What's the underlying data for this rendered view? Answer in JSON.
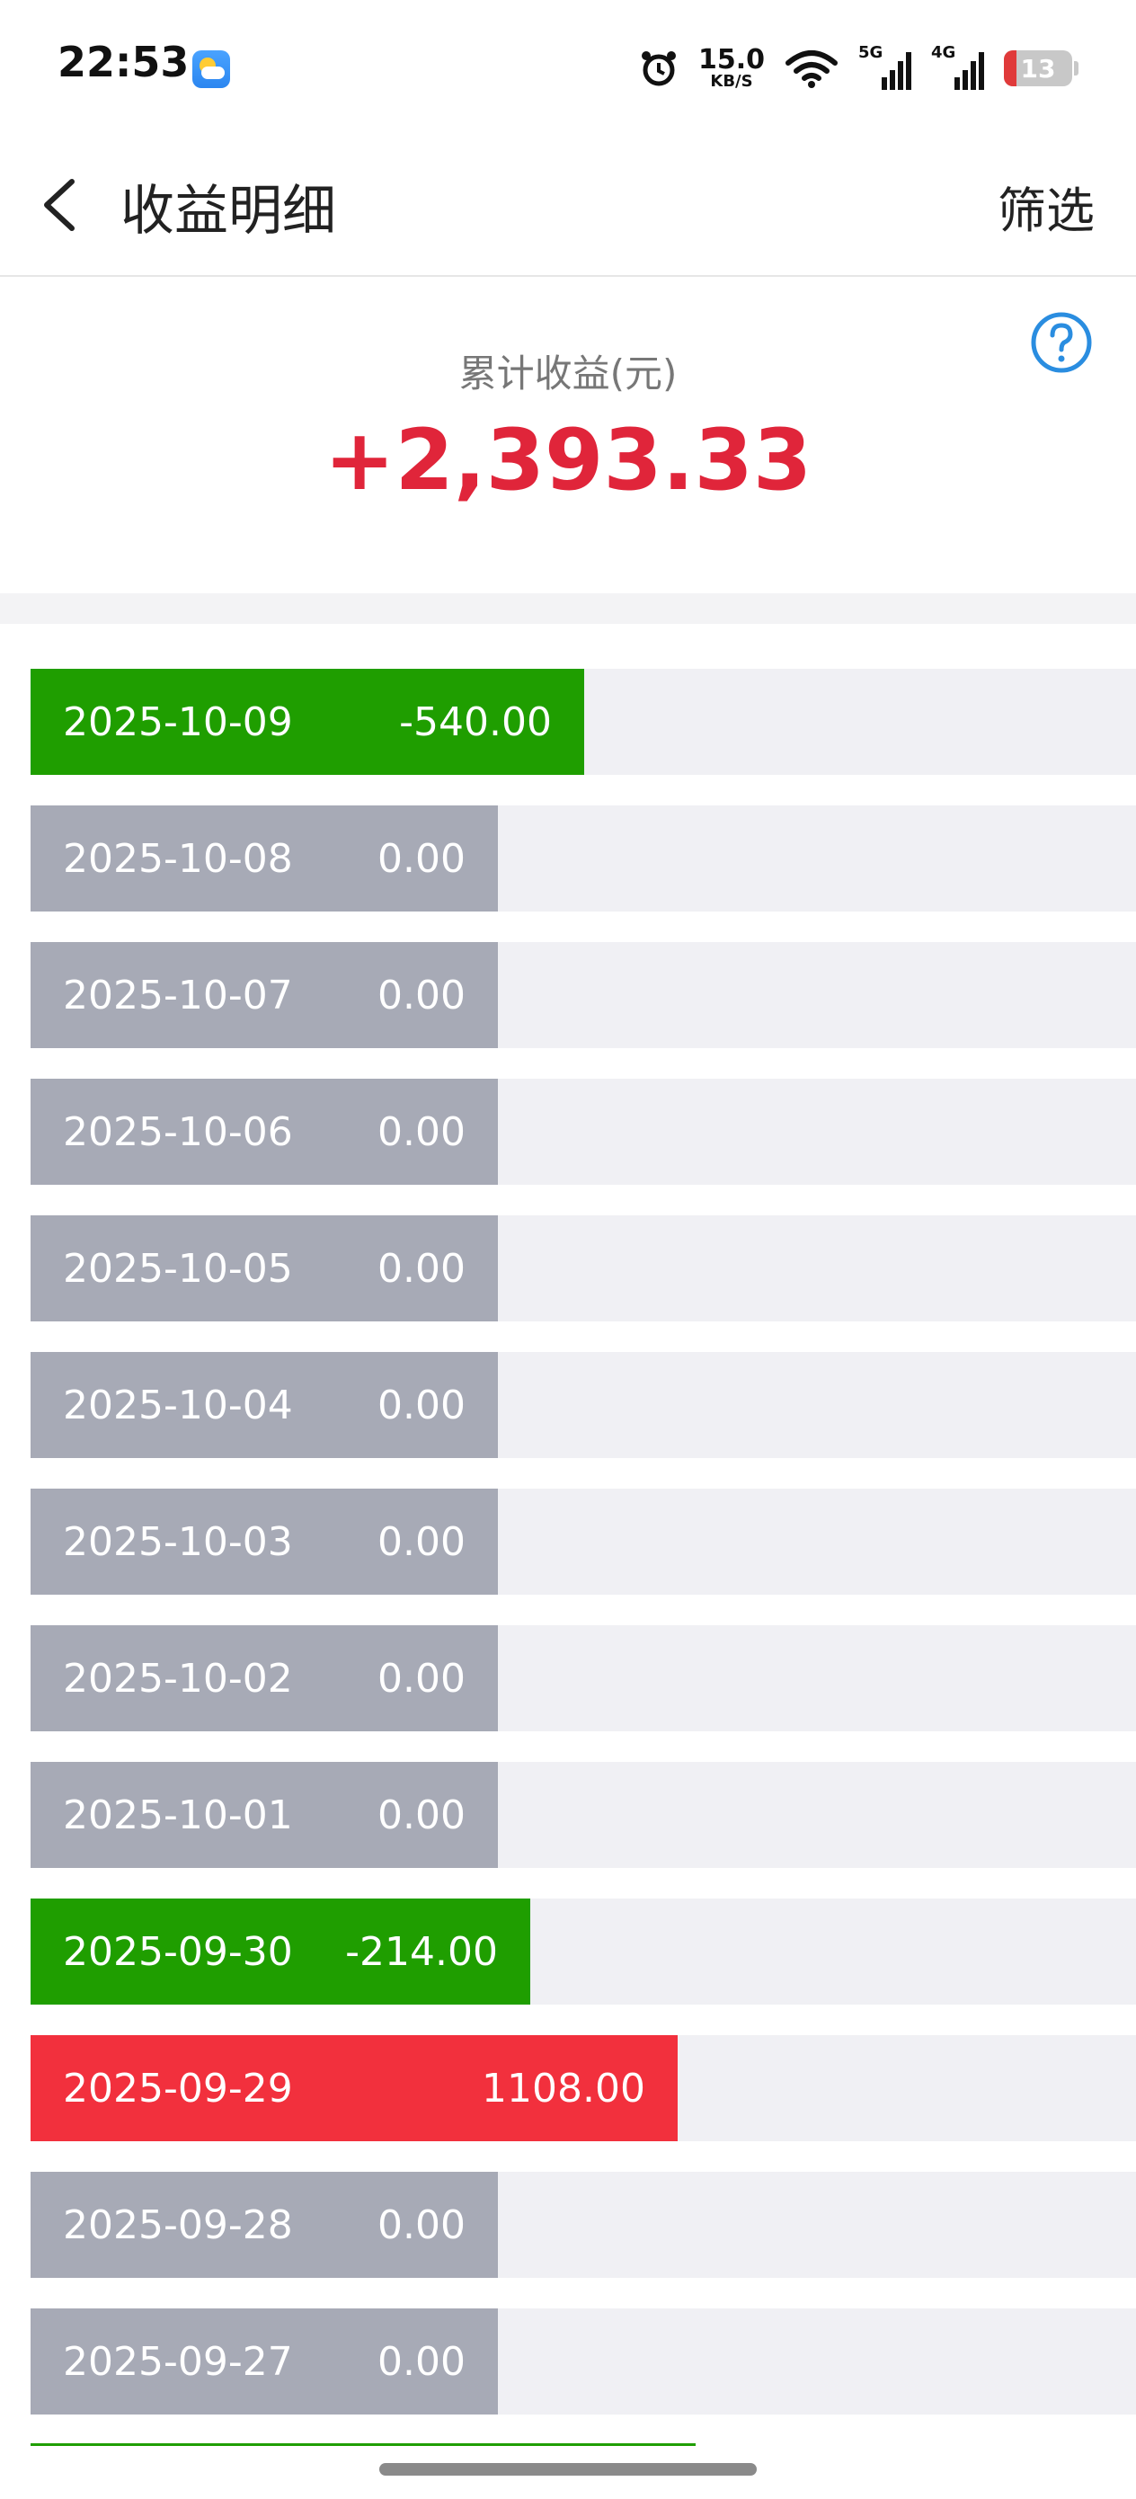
{
  "status_bar": {
    "time": "22:53",
    "net_speed_value": "15.0",
    "net_speed_unit": "KB/S",
    "signal_1_label": "5G",
    "signal_2_label": "4G",
    "battery_level": "13"
  },
  "header": {
    "title": "收益明细",
    "filter_label": "筛选"
  },
  "summary": {
    "label": "累计收益(元)",
    "value": "+2,393.33"
  },
  "colors": {
    "negative": "#1f9e00",
    "positive": "#f2303d",
    "zero": "#a7aab6",
    "summary_value": "#e0253a"
  },
  "rows": [
    {
      "date": "2025-10-09",
      "amount": "-540.00",
      "kind": "neg",
      "value": -540
    },
    {
      "date": "2025-10-08",
      "amount": "0.00",
      "kind": "zero",
      "value": 0
    },
    {
      "date": "2025-10-07",
      "amount": "0.00",
      "kind": "zero",
      "value": 0
    },
    {
      "date": "2025-10-06",
      "amount": "0.00",
      "kind": "zero",
      "value": 0
    },
    {
      "date": "2025-10-05",
      "amount": "0.00",
      "kind": "zero",
      "value": 0
    },
    {
      "date": "2025-10-04",
      "amount": "0.00",
      "kind": "zero",
      "value": 0
    },
    {
      "date": "2025-10-03",
      "amount": "0.00",
      "kind": "zero",
      "value": 0
    },
    {
      "date": "2025-10-02",
      "amount": "0.00",
      "kind": "zero",
      "value": 0
    },
    {
      "date": "2025-10-01",
      "amount": "0.00",
      "kind": "zero",
      "value": 0
    },
    {
      "date": "2025-09-30",
      "amount": "-214.00",
      "kind": "neg",
      "value": -214
    },
    {
      "date": "2025-09-29",
      "amount": "1108.00",
      "kind": "pos",
      "value": 1108
    },
    {
      "date": "2025-09-28",
      "amount": "0.00",
      "kind": "zero",
      "value": 0
    },
    {
      "date": "2025-09-27",
      "amount": "0.00",
      "kind": "zero",
      "value": 0
    }
  ]
}
